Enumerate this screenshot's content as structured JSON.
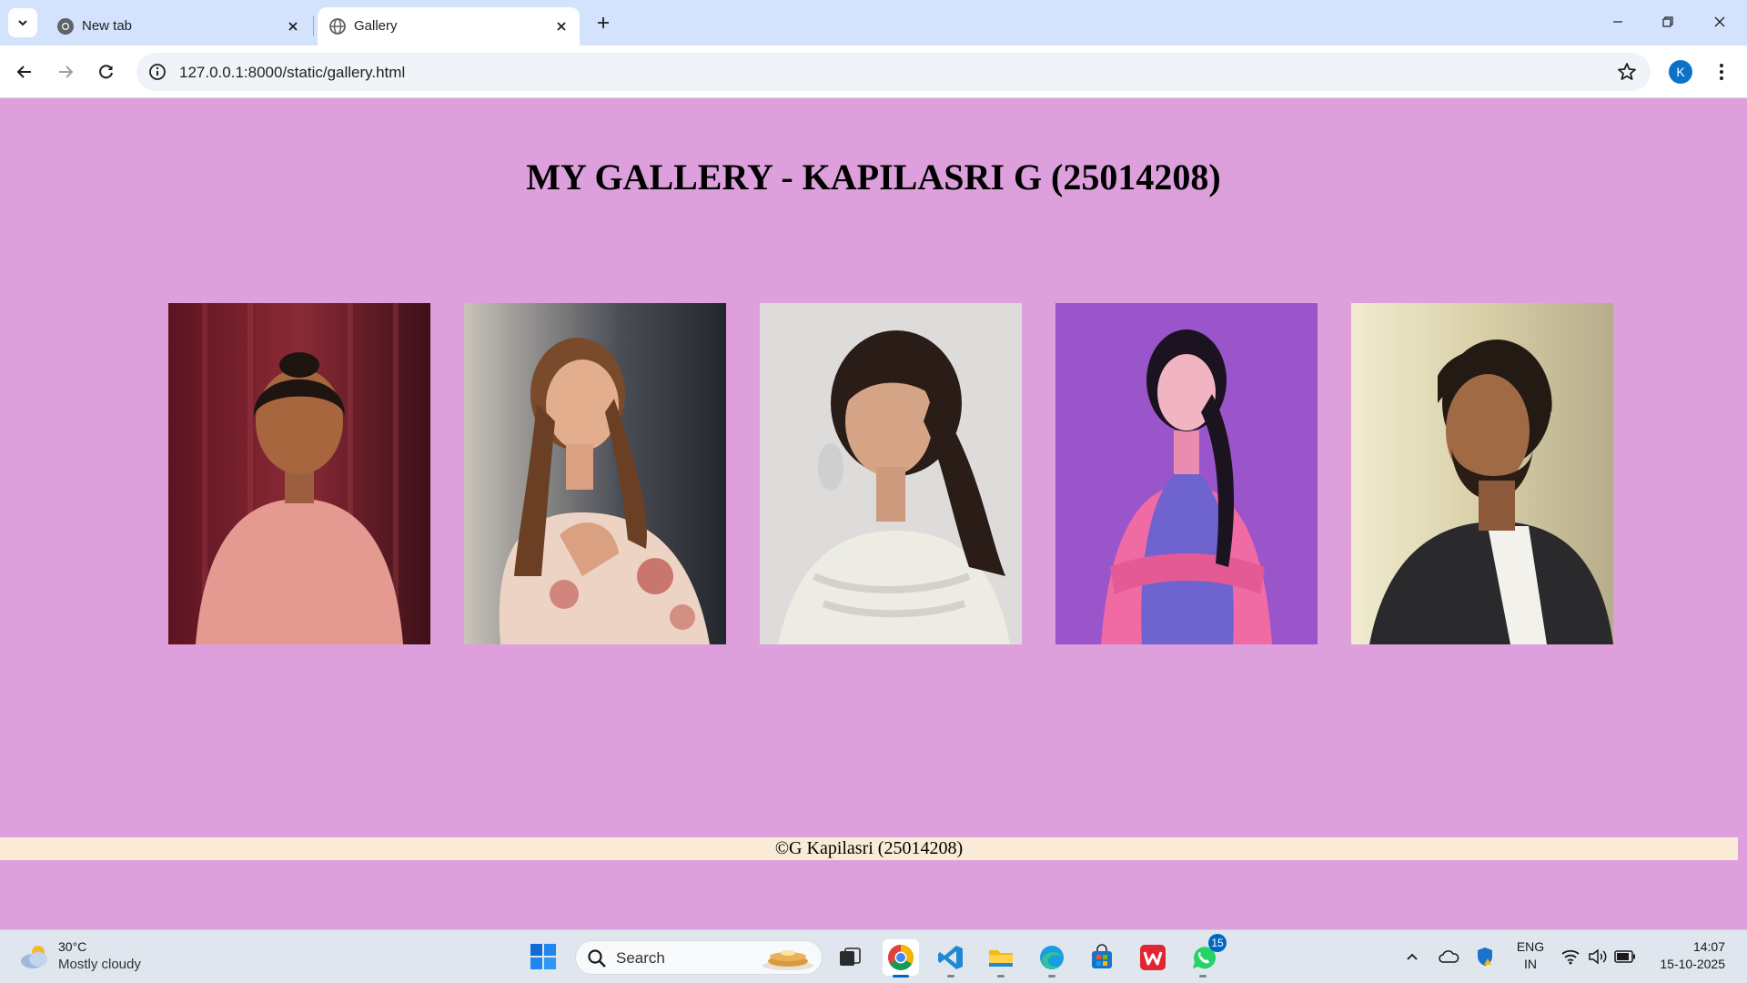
{
  "browser": {
    "tabs": [
      {
        "title": "New tab",
        "active": false
      },
      {
        "title": "Gallery",
        "active": true
      }
    ],
    "url": "127.0.0.1:8000/static/gallery.html",
    "profile_initial": "K"
  },
  "page": {
    "title": "MY GALLERY - KAPILASRI G (25014208)",
    "footer": "©G Kapilasri (25014208)",
    "background": "#dda0dd",
    "footer_background": "#faebd7",
    "images": [
      {
        "label": "photo-1",
        "backdrop": "#7a1f2e",
        "clothing": "#e8998f"
      },
      {
        "label": "photo-2",
        "backdrop": "#3a3a3a",
        "clothing": "#f0d8cc"
      },
      {
        "label": "photo-3",
        "backdrop": "#d9d9d9",
        "clothing": "#efefe8"
      },
      {
        "label": "photo-4",
        "backdrop": "#9b4fc9",
        "clothing": "#6a5fc8"
      },
      {
        "label": "photo-5",
        "backdrop": "#e8e2c4",
        "clothing": "#2a2a2a"
      }
    ]
  },
  "taskbar": {
    "weather": {
      "temp": "30°C",
      "desc": "Mostly cloudy"
    },
    "search_label": "Search",
    "apps": [
      "task-view",
      "chrome",
      "vscode",
      "file-explorer",
      "edge",
      "store",
      "wps",
      "whatsapp"
    ],
    "whatsapp_badge": "15",
    "lang": {
      "line1": "ENG",
      "line2": "IN"
    },
    "clock": {
      "time": "14:07",
      "date": "15-10-2025"
    }
  }
}
